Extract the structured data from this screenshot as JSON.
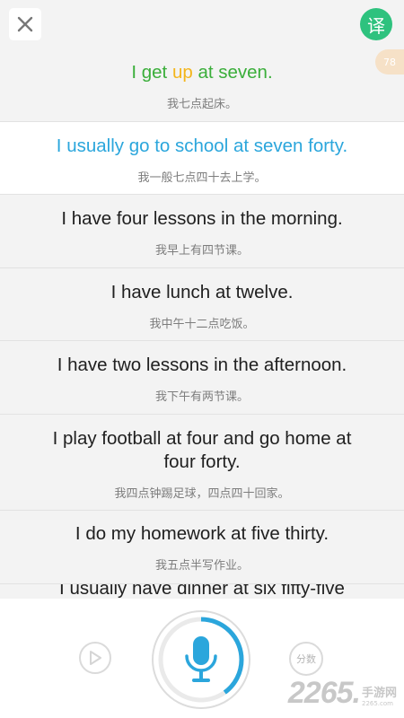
{
  "header": {
    "translate_label": "译",
    "score_badge": "78"
  },
  "sentences": [
    {
      "en_done": "I get ",
      "en_highlight": "up",
      "en_rest": " at seven",
      "en_end": ".",
      "zh": "我七点起床。"
    },
    {
      "en": "I usually go to school at seven forty.",
      "zh": "我一般七点四十去上学。"
    },
    {
      "en": "I have four lessons in the morning.",
      "zh": "我早上有四节课。"
    },
    {
      "en": "I have lunch at twelve.",
      "zh": "我中午十二点吃饭。"
    },
    {
      "en": "I have two lessons in the afternoon.",
      "zh": "我下午有两节课。"
    },
    {
      "en": "I play football at four and go home at four forty.",
      "zh": "我四点钟踢足球，四点四十回家。"
    },
    {
      "en": "I do my homework at five thirty.",
      "zh": "我五点半写作业。"
    },
    {
      "en": "I usually have dinner at six fifty-five",
      "zh": ""
    }
  ],
  "controls": {
    "score_label": "分数",
    "mic_progress": 0.4,
    "accent": "#2ba6dc"
  },
  "watermark": {
    "number": "2265",
    "dot": ".",
    "cn": "手游网",
    "url": "2265.com"
  }
}
